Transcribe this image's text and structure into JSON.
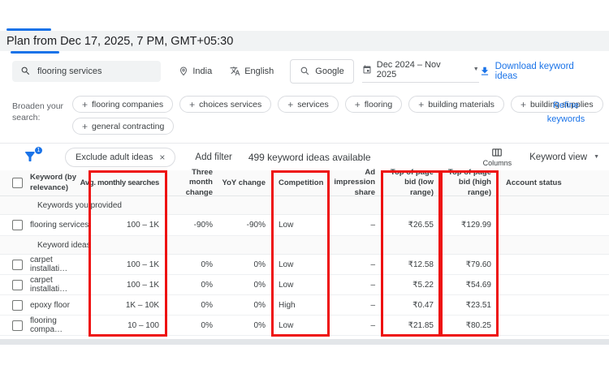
{
  "header": {
    "title": "Plan from Dec 17, 2025, 7 PM, GMT+05:30"
  },
  "toolbar": {
    "search_value": "flooring services",
    "location": "India",
    "language": "English",
    "network": "Google",
    "date_range": "Dec 2024 – Nov 2025",
    "download_label": "Download keyword ideas"
  },
  "broaden": {
    "label": "Broaden your search:",
    "chips": [
      "flooring companies",
      "choices services",
      "services",
      "flooring",
      "building materials",
      "building supplies",
      "general contracting"
    ],
    "refine_label": "Refine keywords"
  },
  "filter_bar": {
    "filter_count": "1",
    "chip_label": "Exclude adult ideas",
    "add_filter_label": "Add filter",
    "ideas_count_label": "499 keyword ideas available",
    "columns_label": "Columns",
    "view_label": "Keyword view"
  },
  "table": {
    "columns": [
      "Keyword (by relevance)",
      "Avg. monthly searches",
      "Three month change",
      "YoY change",
      "Competition",
      "Ad impression share",
      "Top of page bid (low range)",
      "Top of page bid (high range)",
      "Account status"
    ],
    "sections": [
      {
        "label": "Keywords you provided",
        "rows": [
          {
            "keyword": "flooring services",
            "avg": "100 – 1K",
            "three_month": "-90%",
            "yoy": "-90%",
            "competition": "Low",
            "ad_share": "–",
            "bid_low": "₹26.55",
            "bid_high": "₹129.99",
            "account_status": ""
          }
        ]
      },
      {
        "label": "Keyword ideas",
        "rows": [
          {
            "keyword": "carpet installati…",
            "avg": "100 – 1K",
            "three_month": "0%",
            "yoy": "0%",
            "competition": "Low",
            "ad_share": "–",
            "bid_low": "₹12.58",
            "bid_high": "₹79.60",
            "account_status": ""
          },
          {
            "keyword": "carpet installati…",
            "avg": "100 – 1K",
            "three_month": "0%",
            "yoy": "0%",
            "competition": "Low",
            "ad_share": "–",
            "bid_low": "₹5.22",
            "bid_high": "₹54.69",
            "account_status": ""
          },
          {
            "keyword": "epoxy floor",
            "avg": "1K – 10K",
            "three_month": "0%",
            "yoy": "0%",
            "competition": "High",
            "ad_share": "–",
            "bid_low": "₹0.47",
            "bid_high": "₹23.51",
            "account_status": ""
          },
          {
            "keyword": "flooring compa…",
            "avg": "10 – 100",
            "three_month": "0%",
            "yoy": "0%",
            "competition": "Low",
            "ad_share": "–",
            "bid_low": "₹21.85",
            "bid_high": "₹80.25",
            "account_status": ""
          }
        ]
      }
    ],
    "highlighted_columns": [
      "Avg. monthly searches",
      "Competition",
      "Top of page bid (low range)",
      "Top of page bid (high range)"
    ]
  },
  "colors": {
    "accent": "#1a73e8",
    "highlight": "#ee1111"
  }
}
